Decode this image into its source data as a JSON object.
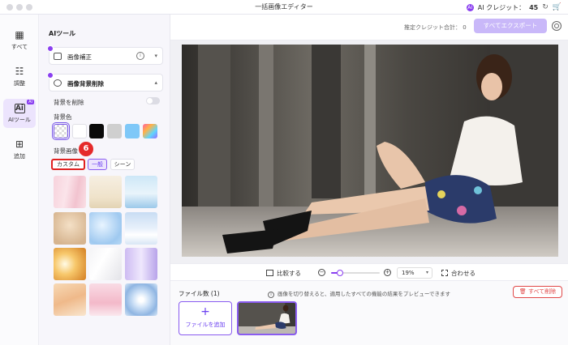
{
  "window": {
    "title": "一括画像エディター",
    "credit_label": "AI クレジット：",
    "credit_value": "45",
    "ai_badge": "AI"
  },
  "nav": {
    "items": [
      {
        "label": "すべて",
        "icon": "grid-icon"
      },
      {
        "label": "調整",
        "icon": "sliders-icon"
      },
      {
        "label": "AIツール",
        "icon": "ai-icon",
        "badge": "AI",
        "active": true
      },
      {
        "label": "追加",
        "icon": "plus-square-icon"
      }
    ]
  },
  "panel": {
    "title": "AIツール",
    "sections": [
      {
        "label": "画像補正",
        "state": "collapsed"
      },
      {
        "label": "画像背景削除",
        "state": "expanded"
      }
    ],
    "remove_bg_label": "背景を削除",
    "remove_bg_enabled": false,
    "bg_color_label": "背景色",
    "bg_colors": [
      "transparent",
      "#ffffff",
      "#0a0a0a",
      "#cfcfcf",
      "#7fc8f8",
      "gradient"
    ],
    "bg_image_label": "背景画像",
    "tabs": [
      "カスタム",
      "一般",
      "シーン"
    ],
    "active_tab": "一般",
    "highlighted_tab": "カスタム",
    "step_badge": "6",
    "background_images": [
      "pink-curtain",
      "soft-cream",
      "blue-sky",
      "beige-wall",
      "blue-glitter",
      "clouds",
      "golden-light",
      "white-room",
      "lavender-drape",
      "warm-shapes",
      "pink-floor",
      "light-tunnel"
    ]
  },
  "topbar": {
    "estimate_label": "推定クレジット合計：",
    "estimate_value": "0",
    "export_label": "すべてエクスポート"
  },
  "controls": {
    "compare_label": "比較する",
    "zoom_value": "19%",
    "zoom_fraction": 0.19,
    "fit_label": "合わせる"
  },
  "files": {
    "count_label": "ファイル数",
    "count_value": "(1)",
    "hint": "画像を切り替えると、適用したすべての機能の結果をプレビューできます",
    "delete_all_label": "すべて削除",
    "add_file_label": "ファイルを追加"
  }
}
